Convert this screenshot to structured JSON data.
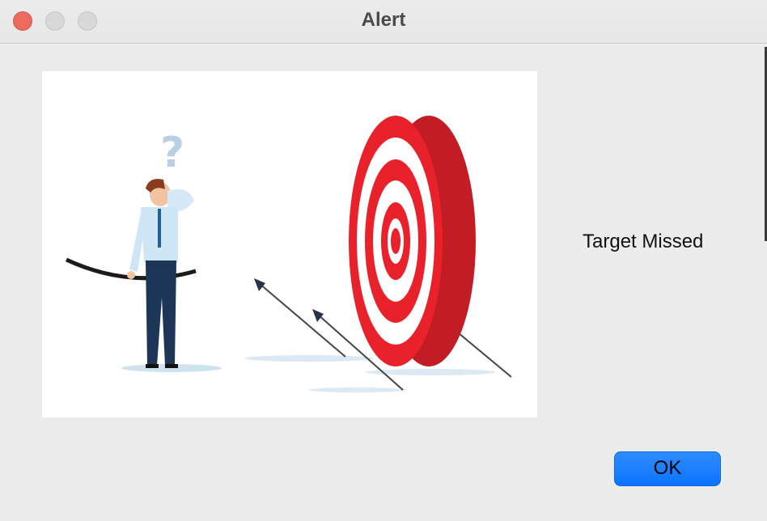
{
  "window": {
    "title": "Alert"
  },
  "alert": {
    "message": "Target Missed",
    "ok_label": "OK"
  },
  "illustration": {
    "name": "archer-missed-target"
  },
  "colors": {
    "close": "#ed6a5e",
    "disabled": "#d8d8d8",
    "accent": "#0a74ff",
    "target_red": "#e8212a"
  }
}
